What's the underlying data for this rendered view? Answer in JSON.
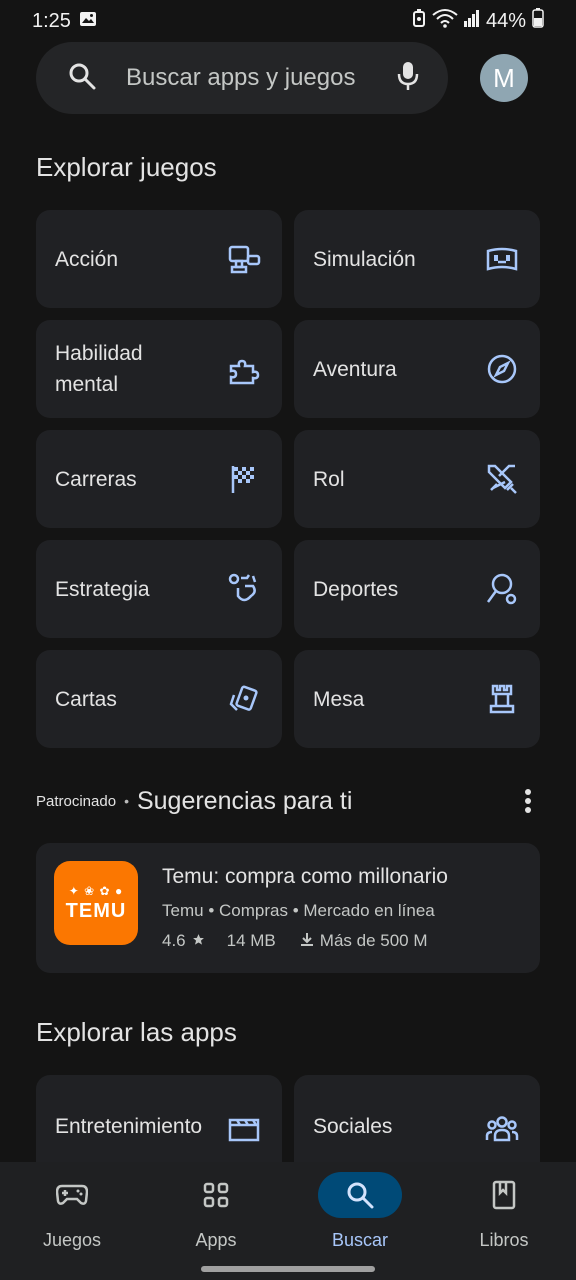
{
  "status_bar": {
    "time": "1:25",
    "battery": "44%"
  },
  "search": {
    "placeholder": "Buscar apps y juegos",
    "avatar_letter": "M"
  },
  "games_section": {
    "title": "Explorar juegos",
    "categories": [
      {
        "label": "Acción",
        "icon": "action-icon"
      },
      {
        "label": "Simulación",
        "icon": "simulation-icon"
      },
      {
        "label": "Habilidad mental",
        "icon": "puzzle-icon"
      },
      {
        "label": "Aventura",
        "icon": "compass-icon"
      },
      {
        "label": "Carreras",
        "icon": "checkered-flag-icon"
      },
      {
        "label": "Rol",
        "icon": "swords-icon"
      },
      {
        "label": "Estrategia",
        "icon": "strategy-icon"
      },
      {
        "label": "Deportes",
        "icon": "racket-icon"
      },
      {
        "label": "Cartas",
        "icon": "cards-icon"
      },
      {
        "label": "Mesa",
        "icon": "chess-rook-icon"
      }
    ]
  },
  "sponsored": {
    "label": "Patrocinado",
    "separator": "•",
    "title": "Sugerencias para ti",
    "app": {
      "name": "Temu: compra como millonario",
      "icon_text": "TEMU",
      "developer": "Temu",
      "category": "Compras",
      "subcategory": "Mercado en línea",
      "rating": "4.6",
      "size": "14 MB",
      "downloads": "Más de 500 M"
    }
  },
  "apps_section": {
    "title": "Explorar las apps",
    "categories": [
      {
        "label": "Entretenimiento",
        "icon": "clapperboard-icon"
      },
      {
        "label": "Sociales",
        "icon": "people-icon"
      }
    ]
  },
  "bottom_nav": [
    {
      "label": "Juegos",
      "icon": "gamepad-icon",
      "active": false
    },
    {
      "label": "Apps",
      "icon": "apps-grid-icon",
      "active": false
    },
    {
      "label": "Buscar",
      "icon": "search-icon",
      "active": true
    },
    {
      "label": "Libros",
      "icon": "book-icon",
      "active": false
    }
  ],
  "colors": {
    "background": "#141414",
    "tile": "#202124",
    "accent_icon": "#a8c7fa",
    "active_nav_pill": "#004a77",
    "temu_orange": "#fb7701"
  }
}
